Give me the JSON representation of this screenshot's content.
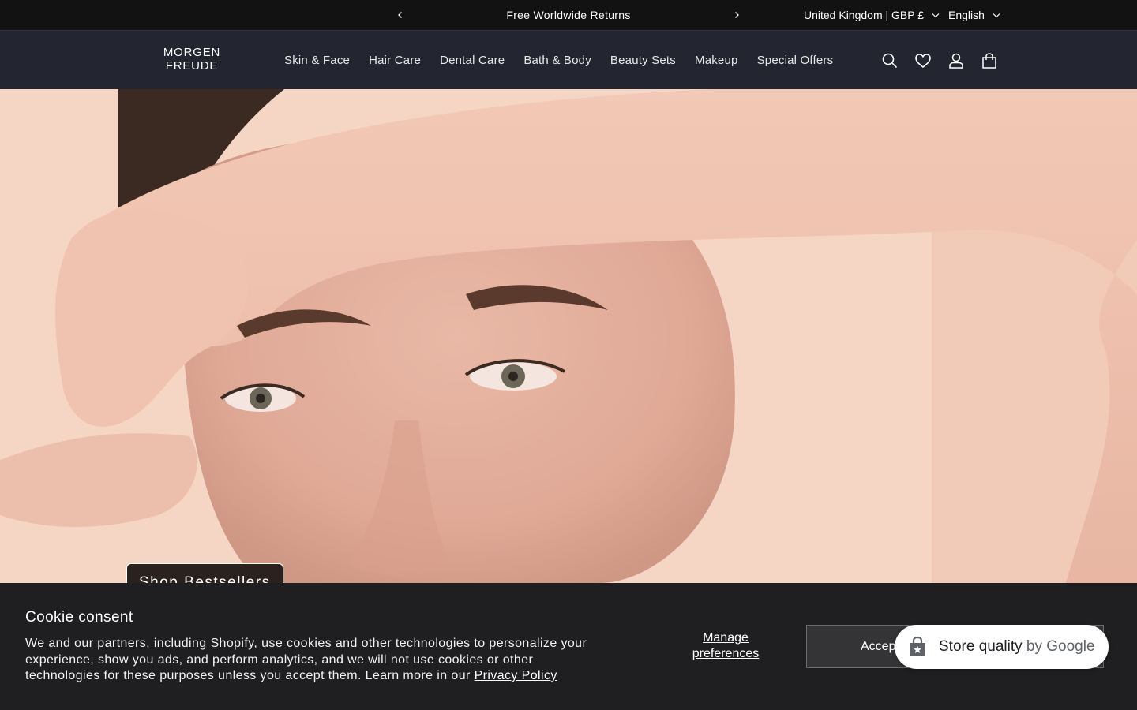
{
  "announcement": {
    "message": "Free Worldwide Returns",
    "prev_icon": "chevron-left-icon",
    "next_icon": "chevron-right-icon",
    "region": "United Kingdom | GBP £",
    "language": "English"
  },
  "header": {
    "logo_line1": "MORGEN",
    "logo_line2": "FREUDE",
    "nav": [
      "Skin & Face",
      "Hair Care",
      "Dental Care",
      "Bath & Body",
      "Beauty Sets",
      "Makeup",
      "Special Offers"
    ],
    "icons": [
      "search-icon",
      "heart-icon",
      "account-icon",
      "cart-icon"
    ]
  },
  "hero": {
    "button_label": "Shop Bestsellers"
  },
  "cookie": {
    "title": "Cookie consent",
    "body": "We and our partners, including Shopify, use cookies and other technologies to personalize your experience, show you ads, and perform analytics, and we will not use cookies or other technologies for these purposes unless you accept them. Learn more in our ",
    "link": "Privacy Policy",
    "manage_line1": "Manage",
    "manage_line2": "preferences",
    "accept_label": "Accept"
  },
  "google_badge": {
    "label": "Store quality",
    "by": "by Google"
  },
  "colors": {
    "announcement_bg": "#121212",
    "header_bg": "#232630",
    "cookie_bg": "#1f1f21",
    "hero_bg": "#f4d4c2",
    "button_bg": "#2b211d"
  }
}
